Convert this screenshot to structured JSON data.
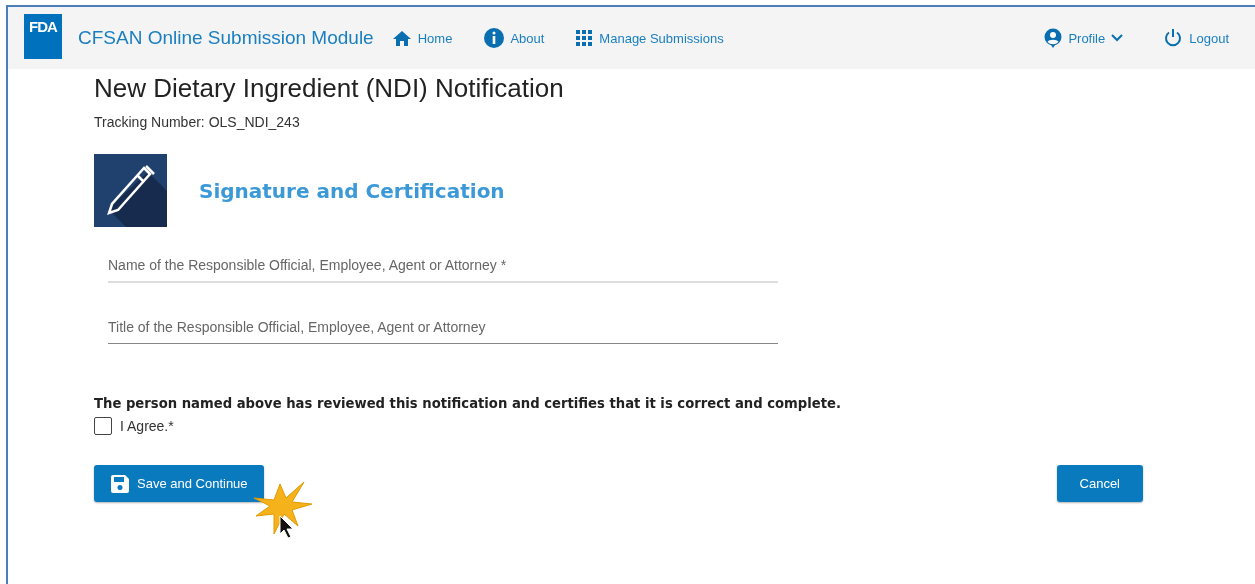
{
  "header": {
    "logo": "FDA",
    "app_title": "CFSAN Online Submission Module",
    "nav": [
      {
        "kind": "home",
        "label": "Home"
      },
      {
        "kind": "about",
        "label": "About"
      },
      {
        "kind": "grid",
        "label": "Manage Submissions"
      }
    ],
    "right_nav": [
      {
        "kind": "profile",
        "label": "Profile"
      },
      {
        "kind": "logout",
        "label": "Logout"
      }
    ]
  },
  "page_title": "New Dietary Ingredient (NDI) Notification",
  "tracking": "Tracking Number: OLS_NDI_243",
  "section_title": "Signature and Certification",
  "fields": [
    {
      "placeholder": "Name of the Responsible Official, Employee, Agent or Attorney *"
    },
    {
      "placeholder": "Title of the Responsible Official, Employee, Agent or Attorney"
    }
  ],
  "certification": "The person named above has reviewed this notification and certifies that it is correct and complete.",
  "agree": {
    "label": "I Agree.*",
    "checked": false
  },
  "buttons": [
    {
      "kind": "save",
      "label": "Save and Continue"
    },
    {
      "kind": "cancel",
      "label": "Cancel"
    }
  ]
}
